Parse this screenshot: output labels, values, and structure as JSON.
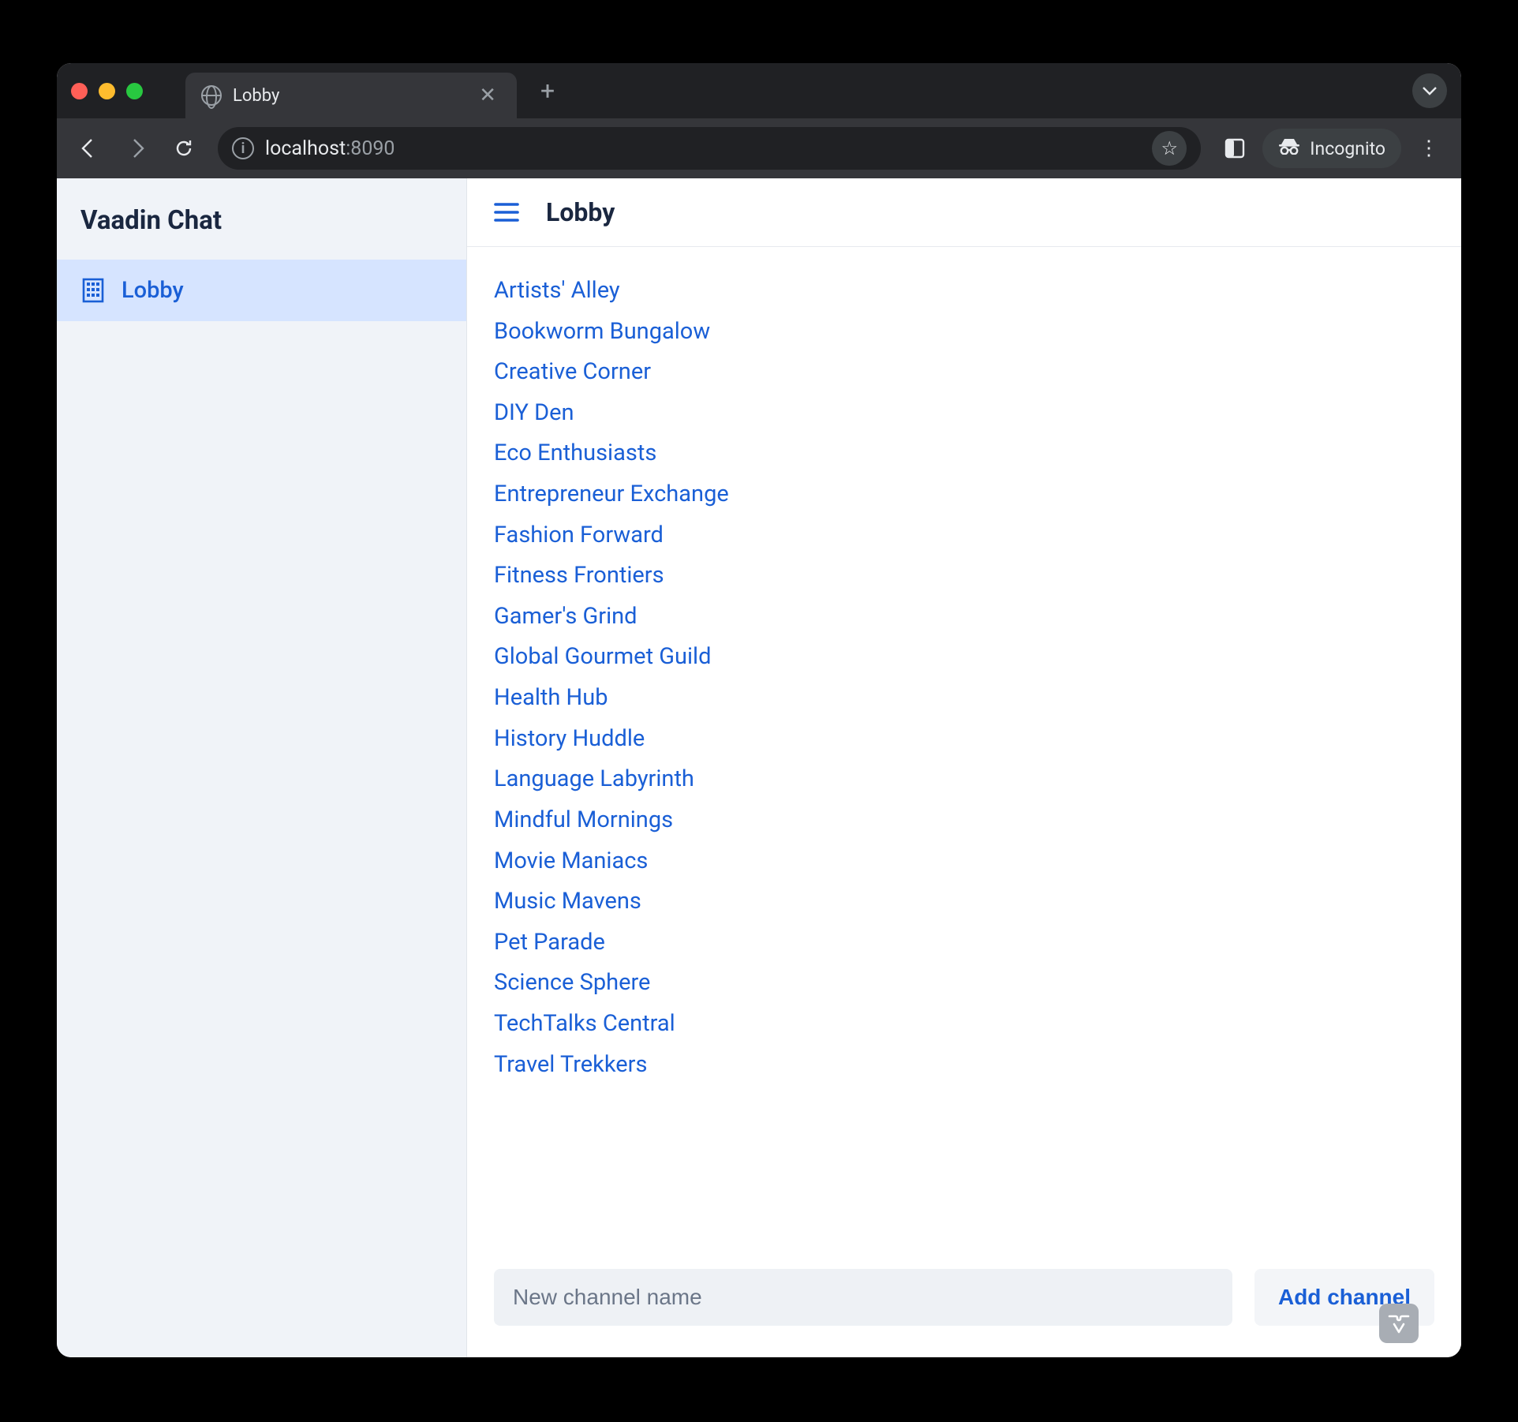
{
  "browser": {
    "tab_title": "Lobby",
    "url_display_host": "localhost",
    "url_display_port": ":8090",
    "incognito_label": "Incognito"
  },
  "sidebar": {
    "app_title": "Vaadin Chat",
    "items": [
      {
        "label": "Lobby"
      }
    ]
  },
  "header": {
    "page_title": "Lobby"
  },
  "channels": [
    "Artists' Alley",
    "Bookworm Bungalow",
    "Creative Corner",
    "DIY Den",
    "Eco Enthusiasts",
    "Entrepreneur Exchange",
    "Fashion Forward",
    "Fitness Frontiers",
    "Gamer's Grind",
    "Global Gourmet Guild",
    "Health Hub",
    "History Huddle",
    "Language Labyrinth",
    "Mindful Mornings",
    "Movie Maniacs",
    "Music Mavens",
    "Pet Parade",
    "Science Sphere",
    "TechTalks Central",
    "Travel Trekkers"
  ],
  "footer": {
    "new_channel_placeholder": "New channel name",
    "new_channel_value": "",
    "add_button_label": "Add channel"
  },
  "colors": {
    "link": "#1a5fd6",
    "sidebar_bg": "#f0f3f8",
    "sidebar_active_bg": "#d6e4ff"
  }
}
